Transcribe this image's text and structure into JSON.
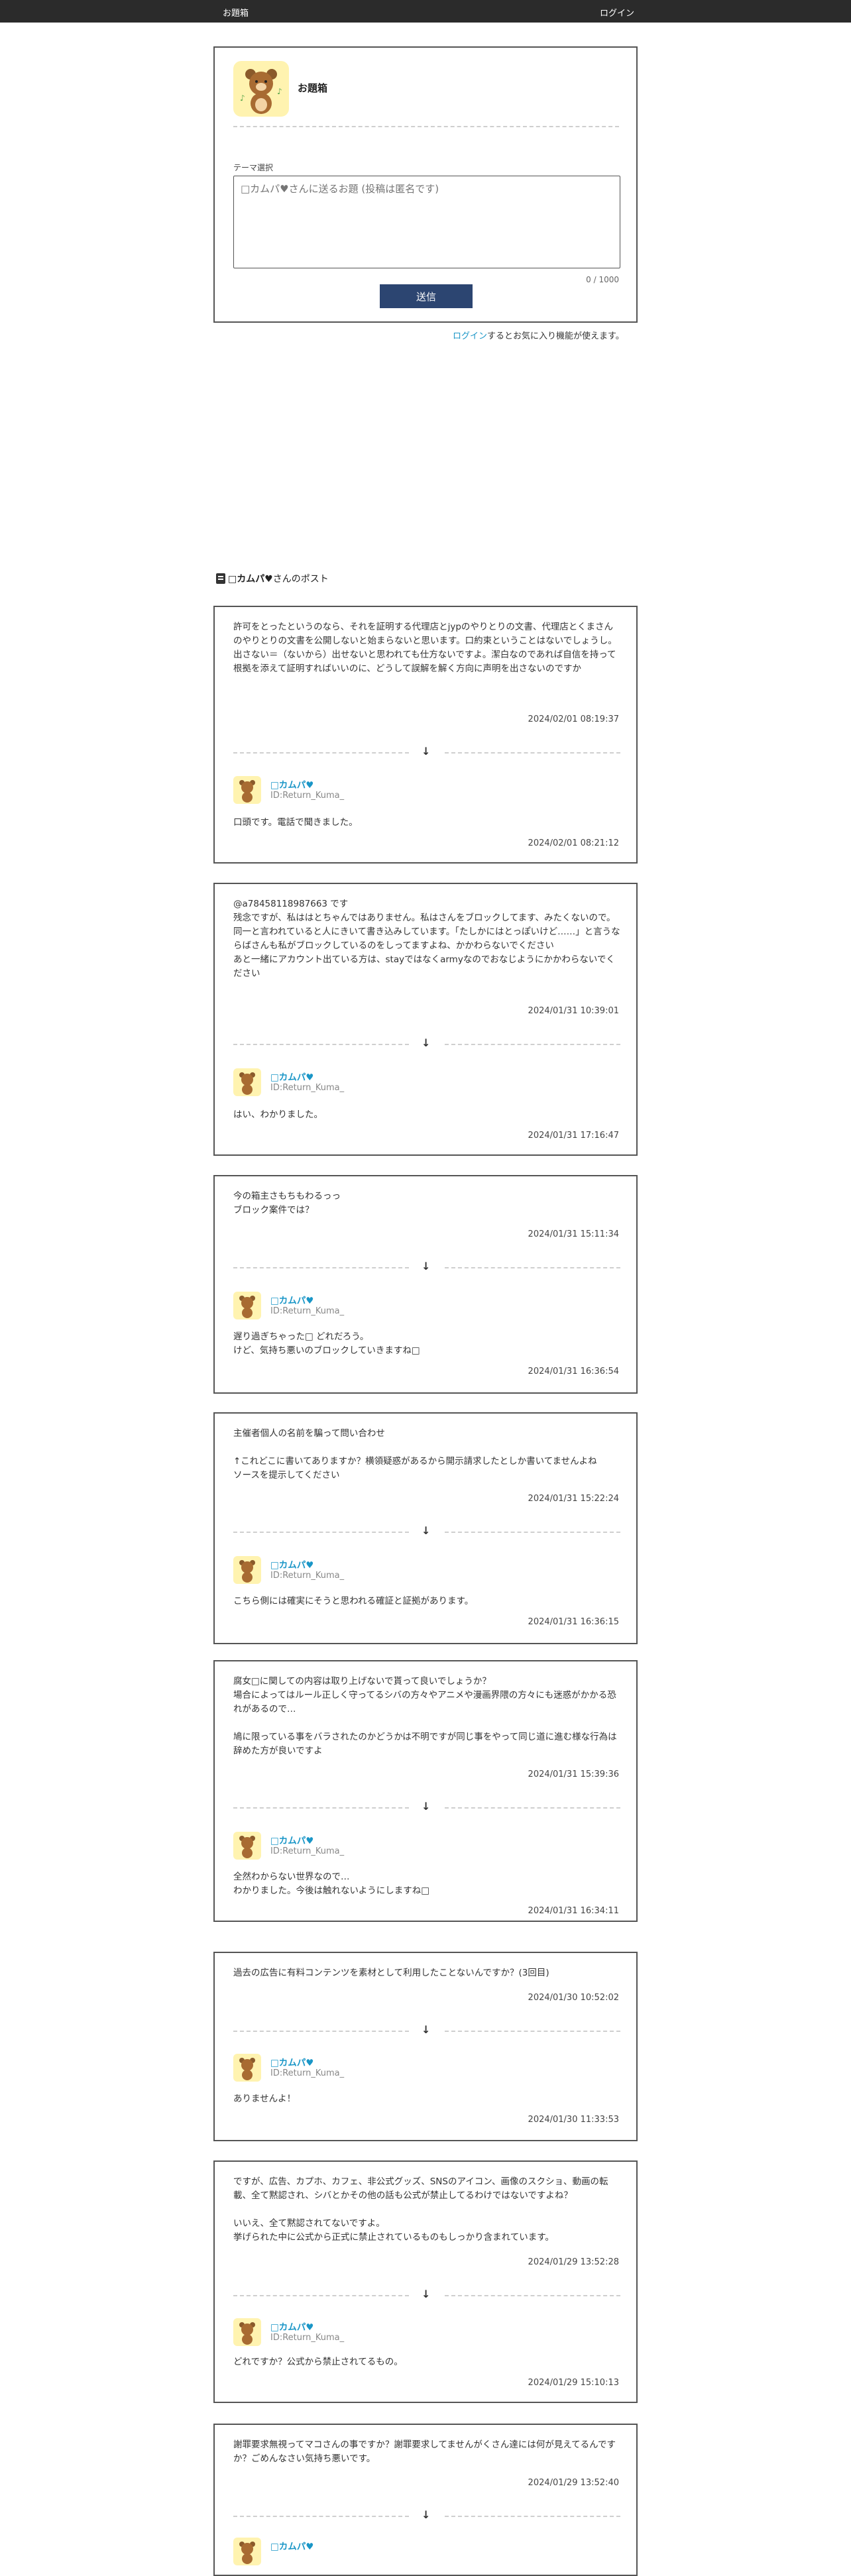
{
  "nav": {
    "brand": "お題箱",
    "login": "ログイン"
  },
  "form": {
    "title": "お題箱",
    "theme_label": "テーマ選択",
    "placeholder": "□カムパ♥さんに送るお題 (投稿は匿名です)",
    "counter": "0 / 1000",
    "send_label": "送信"
  },
  "login_note": {
    "link": "ログイン",
    "text": "するとお気に入り機能が使えます。"
  },
  "posts_heading": {
    "name": "□カムパ♥",
    "suffix": "さんのポスト"
  },
  "user": {
    "name": "□カムパ♥",
    "id": "ID:Return_Kuma_"
  },
  "posts": [
    {
      "question": "許可をとったというのなら、それを証明する代理店とjypのやりとりの文書、代理店とくまさんのやりとりの文書を公開しないと始まらないと思います。口約束ということはないでしょうし。\n出さない＝（ないから）出せないと思われても仕方ないですよ。潔白なのであれば自信を持って根拠を添えて証明すればいいのに、どうして誤解を解く方向に声明を出さないのですか",
      "q_time": "2024/02/01 08:19:37",
      "answer": "口頭です。電話で聞きました。",
      "a_time": "2024/02/01 08:21:12"
    },
    {
      "question": "@a78458118987663 です\n残念ですが、私ははとちゃんではありません。私はさんをブロックしてます、みたくないので。\n同一と言われていると人にきいて書き込みしています。「たしかにはとっぽいけど……」と言うならばさんも私がブロックしているのをしってますよね、かかわらないでください\nあと一緒にアカウント出ている方は、stayではなくarmyなのでおなじようにかかわらないでください",
      "q_time": "2024/01/31 10:39:01",
      "answer": "はい、わかりました。",
      "a_time": "2024/01/31 17:16:47"
    },
    {
      "question": "今の箱主さもちもわるっっ\nブロック案件では？",
      "q_time": "2024/01/31 15:11:34",
      "answer": "遅り過ぎちゃった□ どれだろう。\nけど、気持ち悪いのブロックしていきますね□",
      "a_time": "2024/01/31 16:36:54"
    },
    {
      "question": "主催者個人の名前を騙って問い合わせ\n\n↑これどこに書いてありますか？横領疑惑があるから開示請求したとしか書いてませんよね\nソースを提示してください",
      "q_time": "2024/01/31 15:22:24",
      "answer": "こちら側には確実にそうと思われる確証と証拠があります。",
      "a_time": "2024/01/31 16:36:15"
    },
    {
      "question": "腐女□に関しての内容は取り上げないで貰って良いでしょうか？\n場合によってはルール正しく守ってるシバの方々やアニメや漫画界隈の方々にも迷惑がかかる恐れがあるので…\n\n鳩に限っている事をバラされたのかどうかは不明ですが同じ事をやって同じ道に進む様な行為は辞めた方が良いですよ",
      "q_time": "2024/01/31 15:39:36",
      "answer": "全然わからない世界なので…\nわかりました。今後は触れないようにしますね□",
      "a_time": "2024/01/31 16:34:11"
    },
    {
      "question": "過去の広告に有料コンテンツを素材として利用したことないんですか？(3回目)",
      "q_time": "2024/01/30 10:52:02",
      "answer": "ありませんよ！",
      "a_time": "2024/01/30 11:33:53"
    },
    {
      "question": "ですが、広告、カプホ、カフェ、非公式グッズ、SNSのアイコン、画像のスクショ、動画の転載、全て黙認され、シバとかその他の話も公式が禁止してるわけではないですよね？\n\nいいえ、全て黙認されてないですよ。\n挙げられた中に公式から正式に禁止されているものもしっかり含まれています。",
      "q_time": "2024/01/29 13:52:28",
      "answer": "どれですか？公式から禁止されてるもの。",
      "a_time": "2024/01/29 15:10:13"
    },
    {
      "question": "謝罪要求無視ってマコさんの事ですか？謝罪要求してませんがくさん達には何が見えてるんですか？ごめんなさい気持ち悪いです。",
      "q_time": "2024/01/29 13:52:40",
      "answer": "",
      "a_time": ""
    }
  ]
}
